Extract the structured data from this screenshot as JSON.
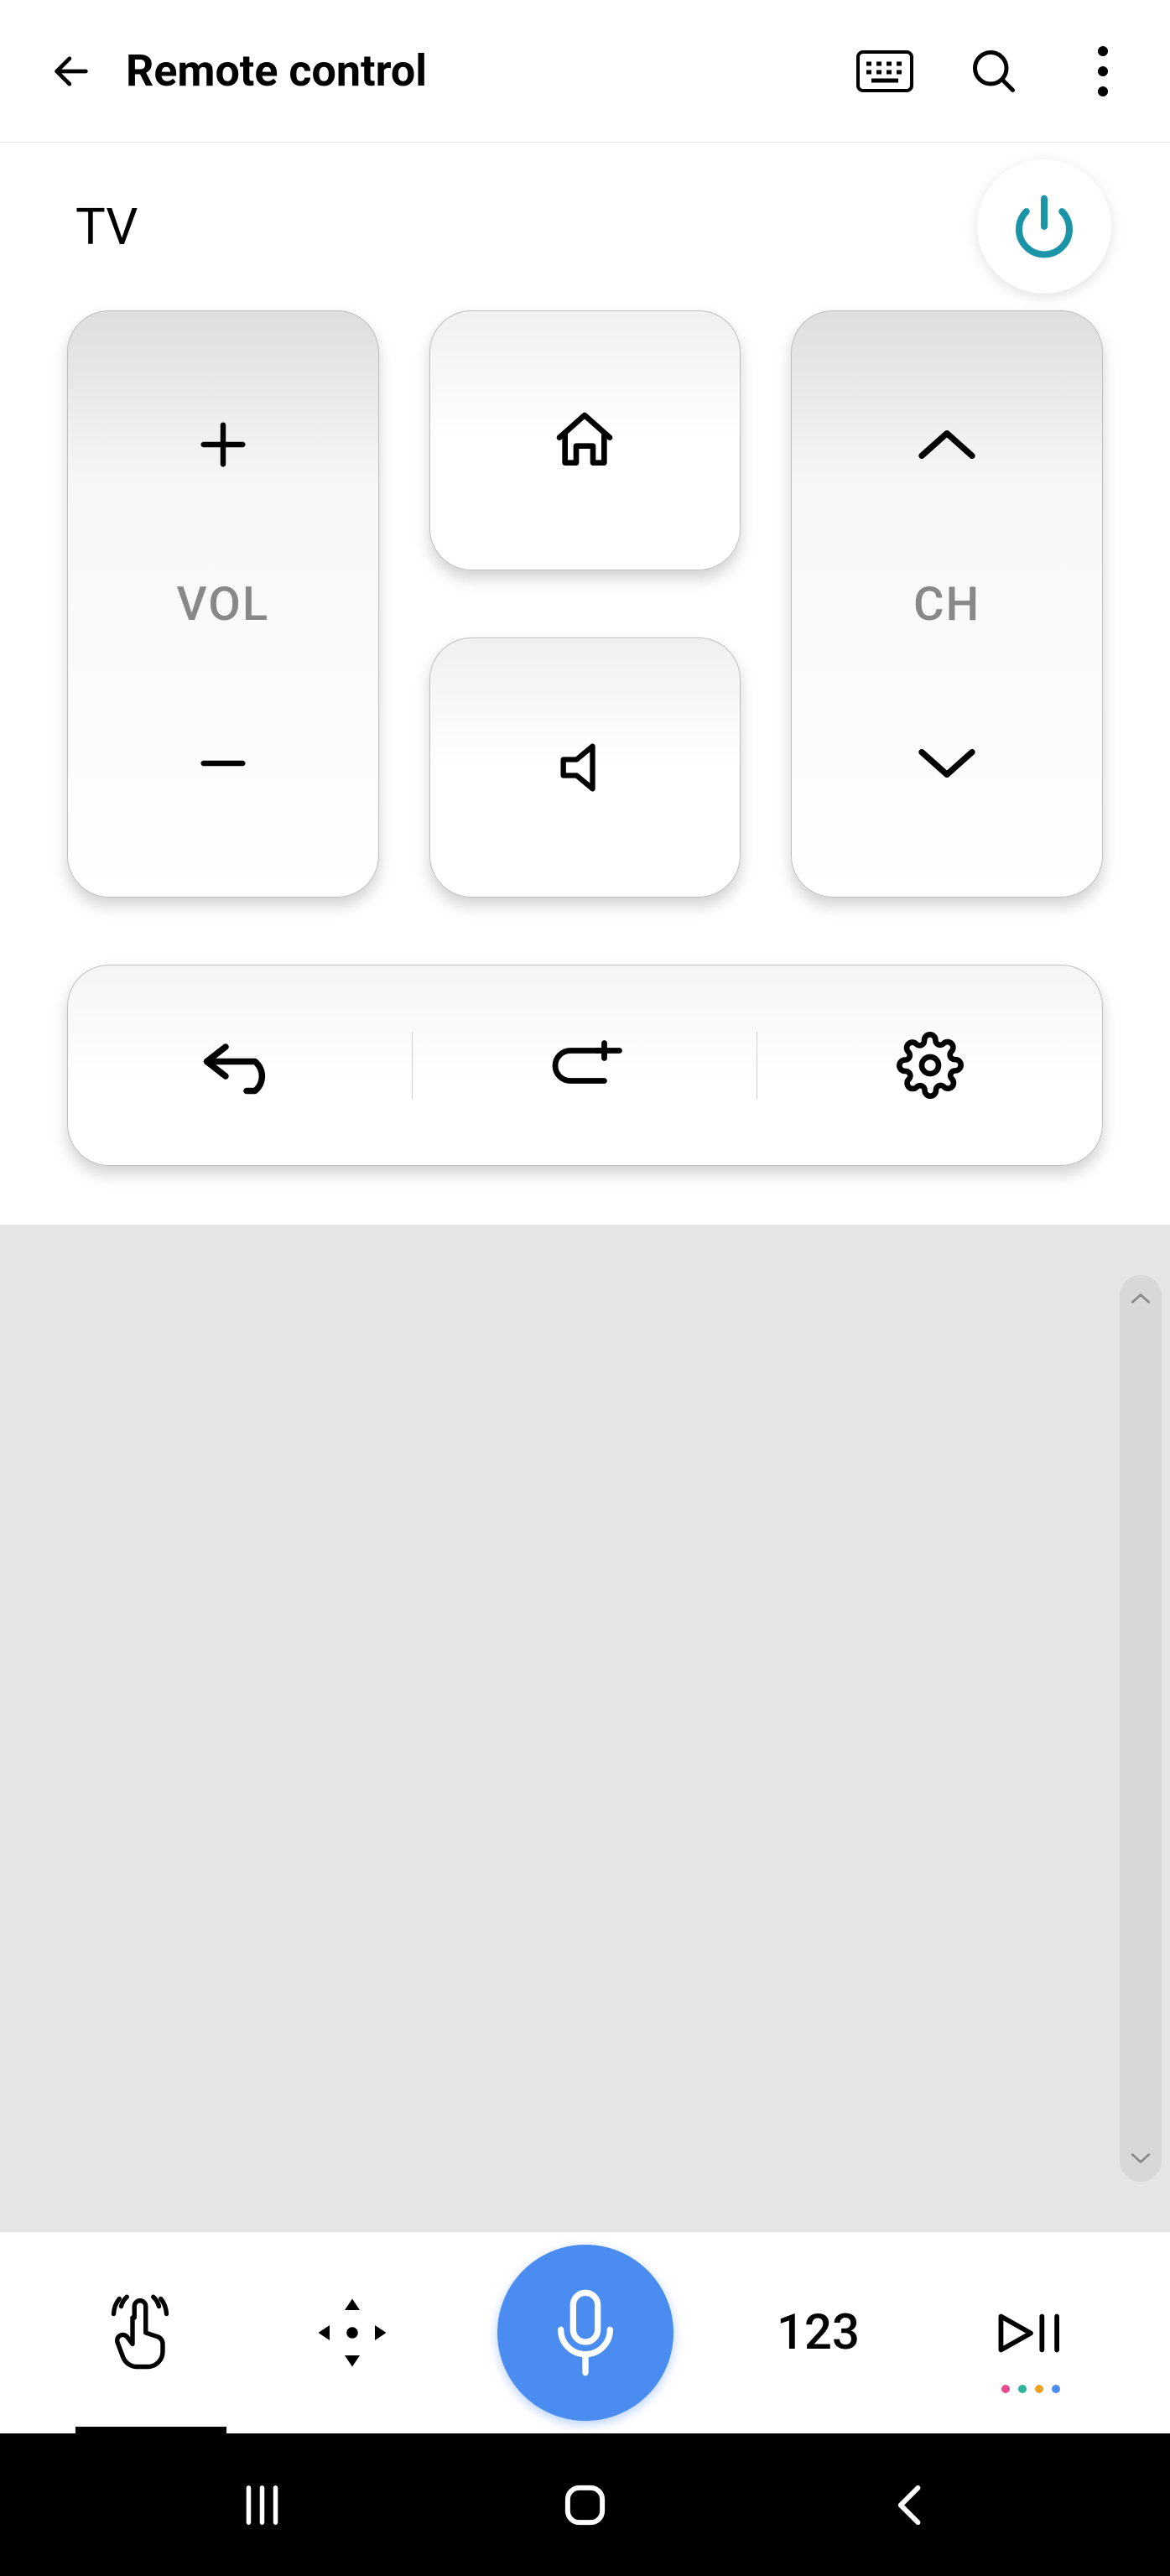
{
  "header": {
    "title": "Remote control"
  },
  "device": {
    "name": "TV"
  },
  "controls": {
    "vol_label": "VOL",
    "ch_label": "CH"
  },
  "bottom_toolbar": {
    "numpad_label": "123"
  },
  "colors": {
    "accent": "#4a8cf0",
    "power": "#1a94a6",
    "dots": [
      "#e84a8a",
      "#2fb4a0",
      "#f0a020",
      "#4a8cf0"
    ]
  }
}
